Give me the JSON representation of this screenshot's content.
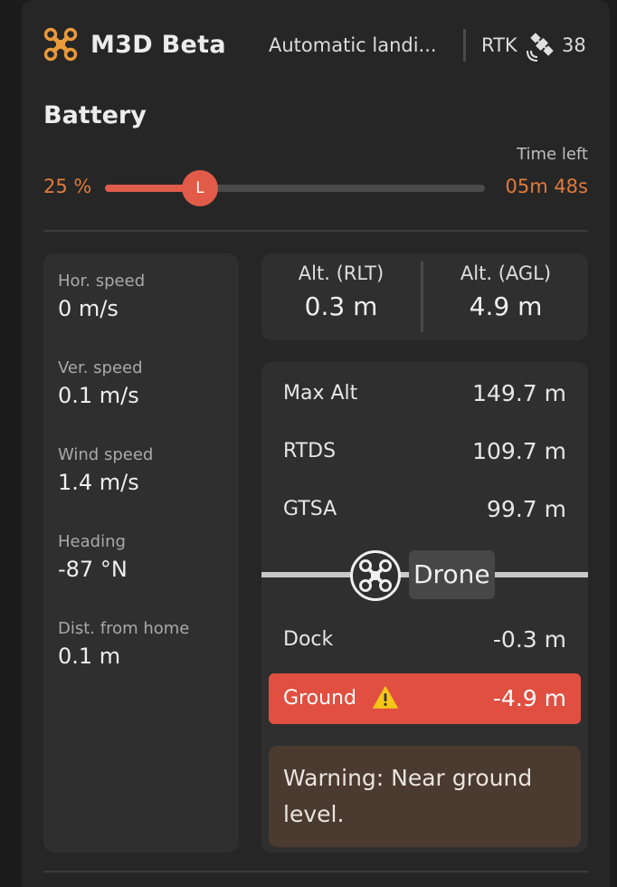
{
  "header": {
    "title": "M3D Beta",
    "status": "Automatic landi...",
    "rtk_label": "RTK",
    "satellite_count": "38",
    "logo_icon": "quadcopter-icon",
    "sat_icon": "satellite-icon",
    "accent": "#e89a3c"
  },
  "battery": {
    "title": "Battery",
    "percent_text": "25 %",
    "percent_value": 0.25,
    "marker_label": "L",
    "time_left_label": "Time left",
    "time_left_value": "05m 48s",
    "accent": "#e07a3c",
    "fill_color": "#e05b4a"
  },
  "stats": [
    {
      "label": "Hor. speed",
      "value": "0 m/s"
    },
    {
      "label": "Ver. speed",
      "value": "0.1 m/s"
    },
    {
      "label": "Wind speed",
      "value": "1.4 m/s"
    },
    {
      "label": "Heading",
      "value": "-87 °N"
    },
    {
      "label": "Dist. from home",
      "value": "0.1 m"
    }
  ],
  "altitude": {
    "rlt_label": "Alt. (RLT)",
    "rlt_value": "0.3 m",
    "agl_label": "Alt. (AGL)",
    "agl_value": "4.9 m"
  },
  "levels": {
    "above": [
      {
        "label": "Max Alt",
        "value": "149.7 m"
      },
      {
        "label": "RTDS",
        "value": "109.7 m"
      },
      {
        "label": "GTSA",
        "value": "99.7 m"
      }
    ],
    "drone_label": "Drone",
    "drone_icon": "quadcopter-icon",
    "dock": {
      "label": "Dock",
      "value": "-0.3 m"
    },
    "ground": {
      "label": "Ground",
      "value": "-4.9 m",
      "icon": "warning-icon",
      "color": "#e04f40"
    },
    "warning_text": "Warning: Near ground level."
  }
}
